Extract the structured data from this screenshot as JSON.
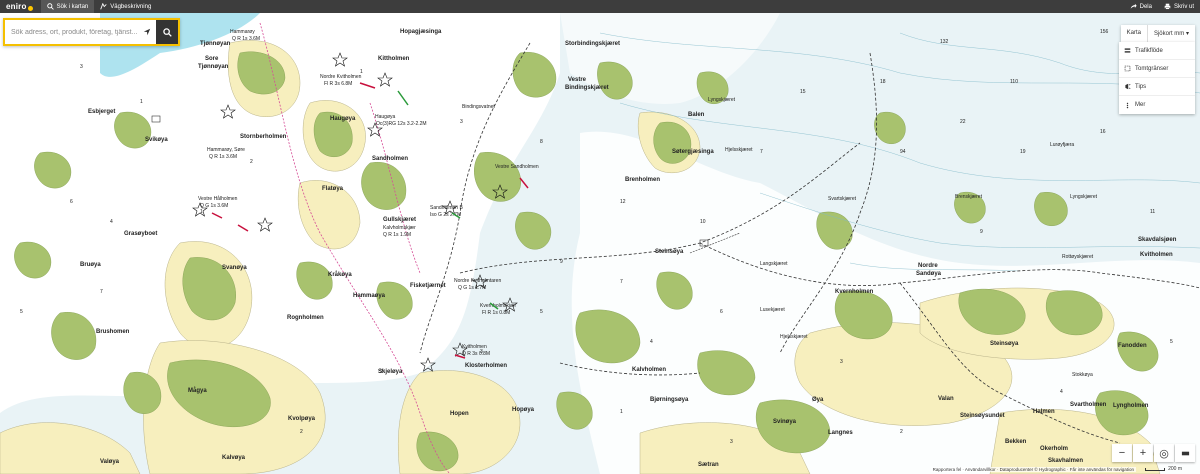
{
  "topbar": {
    "logo": "eniro",
    "nav": [
      {
        "label": "Sök i kartan",
        "icon": "search-icon",
        "active": true
      },
      {
        "label": "Vägbeskrivning",
        "icon": "route-icon",
        "active": false
      }
    ],
    "right": [
      {
        "label": "Dela",
        "icon": "share-icon"
      },
      {
        "label": "Skriv ut",
        "icon": "print-icon"
      }
    ]
  },
  "search": {
    "placeholder": "Sök adress, ort, produkt, företag, tjänst..."
  },
  "maptype": {
    "options": [
      "Karta",
      "Sjökort mm"
    ],
    "selected": "Sjökort mm"
  },
  "layers": [
    {
      "label": "Trafikflöde",
      "icon": "traffic-icon"
    },
    {
      "label": "Tomtgränser",
      "icon": "plot-boundary-icon"
    },
    {
      "label": "Tips",
      "icon": "tips-icon"
    },
    {
      "label": "Mer",
      "icon": "more-icon"
    }
  ],
  "controls": {
    "zoom_out": "−",
    "zoom_in": "+",
    "locate": "◎"
  },
  "scale": "200 m",
  "attribution": "Rapportera fel · Användarvillkor · Dataproducenter © Hydrographic · Får inte användas för navigation",
  "colors": {
    "water": "#e9f3f6",
    "shallow": "#ffffff",
    "land": "#f7efbe",
    "vegetation": "#a8c26e",
    "accent": "#f5c000",
    "topbar": "#3d3d3d"
  },
  "place_labels": [
    "Tjønnøyan",
    "Sore Tjønnøyan",
    "Hammarøy",
    "Holmen",
    "Langsøya",
    "Hopagjæsinga",
    "Kittholmen",
    "Storbindingskjæret",
    "Vestre Bindingskjæret",
    "Haugøya",
    "Stornberholmen",
    "Sandholmen",
    "Esbjerget",
    "Svikøya",
    "Balen",
    "Søtergjæsinga",
    "Flatøya",
    "Brenholmen",
    "Gullskjæret",
    "Steinsøya",
    "Kråkøya",
    "Hammaøya",
    "Brushomen",
    "Rognholmen",
    "Skjeløya",
    "Klosterholmen",
    "Kalvholmen",
    "Fisketjærnet",
    "Nordre Sandøya",
    "Kvernholmen",
    "Steinsøya",
    "Fanodden",
    "Kvitholmen",
    "Mågya",
    "Kvolpøya",
    "Hopen",
    "Hopøya",
    "Bjørningsøya",
    "Svinøya",
    "Langnes",
    "Sætran",
    "Valøya",
    "Kalvøya",
    "Valan",
    "Steinsøysundet",
    "Halmen",
    "Svartholmen",
    "Lyngholmen",
    "Bekken",
    "Skavhalmen",
    "Okerholm",
    "Grasøyboet",
    "Bruøya",
    "Svanøya",
    "Skavdalsjøen",
    "Øya",
    "Lyngskjæret",
    "Brenskjæret",
    "Svartskjæret",
    "Lurøyfjæra",
    "Hjelsskjæret",
    "Stokkøya",
    "Lusekjæret"
  ],
  "light_labels": [
    "Hammarøy F Q R 1s 3.6M",
    "Nordre Kvitholmen Fl R 3s 6.8M",
    "Haugøya Oc(3)RG 12s 3.2-2.2M",
    "Hammarøy, Søre Q R 1s 3.6M",
    "Vestre Hålholmen Q G 1s 3.6M",
    "Sandholmen B Iso G 2s 2.7M",
    "Kalvholmskjær Q R 1s 1.9M",
    "Kvitholmen Q R 3s 0.8M",
    "Nordre Kvitholmtaren Q G 1s 1.7M",
    "Kvernholmskjær Fl R 1s 0.8M"
  ]
}
